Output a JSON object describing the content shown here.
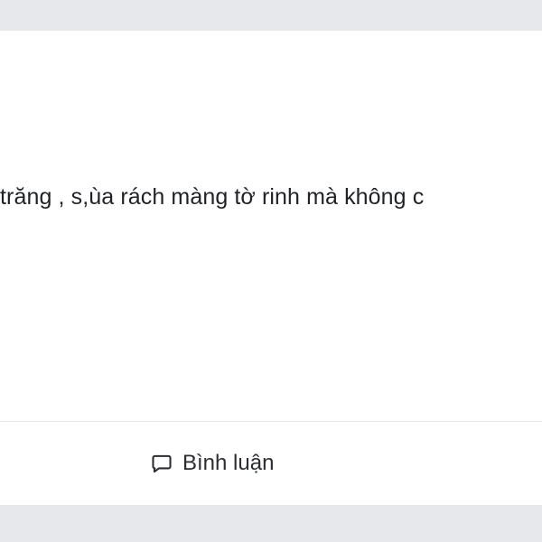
{
  "post": {
    "text": "trăng , s,ùa rách màng tờ rinh mà không c"
  },
  "actions": {
    "comment_label": "Bình luận",
    "comment_icon": "chat-bubble-icon"
  }
}
